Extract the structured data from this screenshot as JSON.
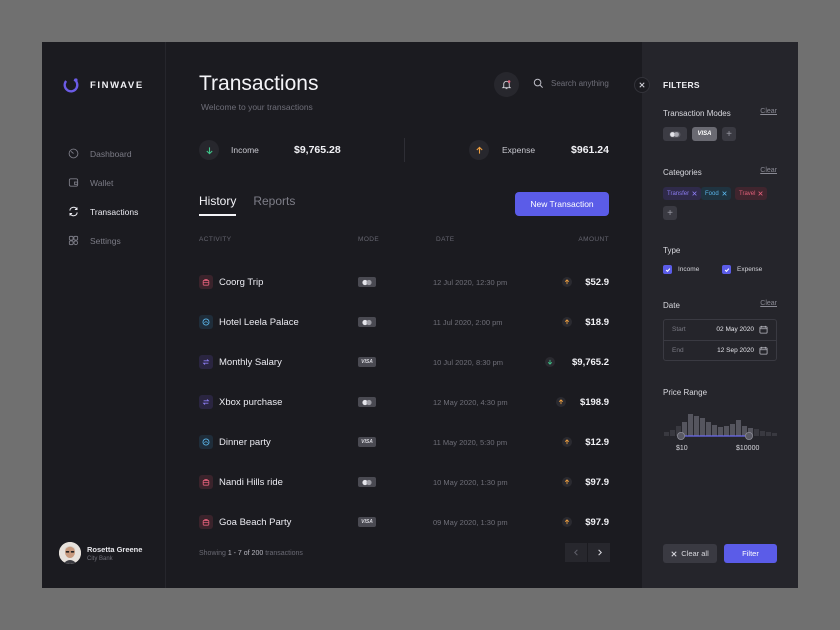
{
  "brand": {
    "name": "FINWAVE",
    "accent": "#6c5ce7"
  },
  "sidebar": {
    "items": [
      {
        "label": "Dashboard",
        "icon": "dashboard-icon"
      },
      {
        "label": "Wallet",
        "icon": "wallet-icon"
      },
      {
        "label": "Transactions",
        "icon": "refresh-icon",
        "active": true
      },
      {
        "label": "Settings",
        "icon": "grid-settings-icon"
      }
    ],
    "user": {
      "name": "Rosetta Greene",
      "sub": "City Bank"
    }
  },
  "header": {
    "title": "Transactions",
    "subtitle": "Welcome to your transactions",
    "search_placeholder": "Search anything"
  },
  "summary": {
    "income": {
      "label": "Income",
      "value": "$9,765.28"
    },
    "expense": {
      "label": "Expense",
      "value": "$961.24"
    }
  },
  "tabs": [
    {
      "label": "History",
      "active": true
    },
    {
      "label": "Reports"
    }
  ],
  "new_transaction_label": "New Transaction",
  "table": {
    "columns": [
      "ACTIVITY",
      "MODE",
      "DATE",
      "AMOUNT"
    ],
    "rows": [
      {
        "name": "Coorg Trip",
        "mode": "card",
        "date": "12 Jul 2020, 12:30 pm",
        "amount": "$52.9",
        "dir": "expense",
        "icon": "bag-icon",
        "icon_color": "#e0607a",
        "icon_bg": "#3a232b"
      },
      {
        "name": "Hotel Leela Palace",
        "mode": "card",
        "date": "11 Jul 2020, 2:00 pm",
        "amount": "$18.9",
        "dir": "expense",
        "icon": "hotel-icon",
        "icon_color": "#5ab4e8",
        "icon_bg": "#1f2d3a"
      },
      {
        "name": "Monthly Salary",
        "mode": "visa",
        "date": "10 Jul 2020, 8:30 pm",
        "amount": "$9,765.2",
        "dir": "income",
        "icon": "transfer-icon",
        "icon_color": "#8b7cf0",
        "icon_bg": "#2a2540"
      },
      {
        "name": "Xbox purchase",
        "mode": "card",
        "date": "12 May 2020, 4:30 pm",
        "amount": "$198.9",
        "dir": "expense",
        "icon": "transfer-icon",
        "icon_color": "#8b7cf0",
        "icon_bg": "#2a2540"
      },
      {
        "name": "Dinner party",
        "mode": "visa",
        "date": "11 May 2020, 5:30 pm",
        "amount": "$12.9",
        "dir": "expense",
        "icon": "hotel-icon",
        "icon_color": "#5ab4e8",
        "icon_bg": "#1f2d3a"
      },
      {
        "name": "Nandi Hills ride",
        "mode": "card",
        "date": "10 May 2020, 1:30 pm",
        "amount": "$97.9",
        "dir": "expense",
        "icon": "bag-icon",
        "icon_color": "#e0607a",
        "icon_bg": "#3a232b"
      },
      {
        "name": "Goa Beach Party",
        "mode": "visa",
        "date": "09 May 2020, 1:30 pm",
        "amount": "$97.9",
        "dir": "expense",
        "icon": "bag-icon",
        "icon_color": "#e0607a",
        "icon_bg": "#3a232b"
      }
    ]
  },
  "pagination": {
    "prefix": "Showing",
    "range": "1 - 7 of 200",
    "suffix": "transactions"
  },
  "filters": {
    "title": "FILTERS",
    "modes": {
      "label": "Transaction Modes",
      "clear": "Clear",
      "visa": "VISA"
    },
    "categories": {
      "label": "Categories",
      "clear": "Clear",
      "items": [
        {
          "label": "Transfer",
          "color": "#8b7cf0",
          "bg": "#2f2a4a"
        },
        {
          "label": "Food",
          "color": "#5ab4e8",
          "bg": "#1f3340"
        },
        {
          "label": "Travel",
          "color": "#e0607a",
          "bg": "#40252e"
        }
      ]
    },
    "type": {
      "label": "Type",
      "income": "Income",
      "expense": "Expense"
    },
    "date": {
      "label": "Date",
      "clear": "Clear",
      "start_label": "Start",
      "start": "02 May 2020",
      "end_label": "End",
      "end": "12 Sep 2020"
    },
    "price_range": {
      "label": "Price Range",
      "min": "$10",
      "max": "$10000"
    },
    "clear_all": "Clear all",
    "apply": "Filter"
  }
}
